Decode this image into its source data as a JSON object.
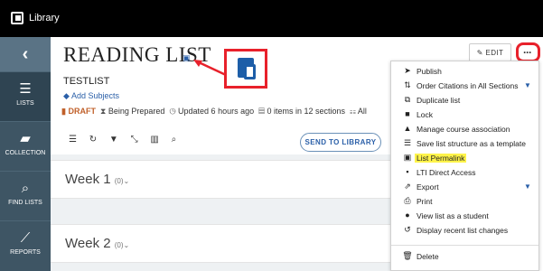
{
  "app": {
    "title": "Library"
  },
  "sidebar": {
    "items": [
      {
        "label": "LISTS",
        "icon": "list-icon"
      },
      {
        "label": "COLLECTION",
        "icon": "folder-icon"
      },
      {
        "label": "FIND LISTS",
        "icon": "search-icon"
      },
      {
        "label": "REPORTS",
        "icon": "chart-icon"
      }
    ]
  },
  "page": {
    "title": "READING LIST",
    "list_name": "TESTLIST",
    "add_subjects": "Add Subjects",
    "meta": {
      "status": "DRAFT",
      "prep": "Being Prepared",
      "updated": "Updated 6 hours ago",
      "items": "0 items in 12 sections",
      "all": "All"
    }
  },
  "toolbar": {
    "send_label": "SEND TO LIBRARY",
    "edit_label": "EDIT",
    "more_label": "···"
  },
  "weeks": [
    {
      "title": "Week 1",
      "count": "(0)"
    },
    {
      "title": "Week 2",
      "count": "(0)"
    }
  ],
  "menu": {
    "items": [
      {
        "label": "Publish",
        "icon": "send-icon"
      },
      {
        "label": "Order Citations in All Sections",
        "icon": "sort-icon",
        "dropdown": "▼"
      },
      {
        "label": "Duplicate list",
        "icon": "copy-icon"
      },
      {
        "label": "Lock",
        "icon": "lock-icon"
      },
      {
        "label": "Manage course association",
        "icon": "graduation-cap-icon"
      },
      {
        "label": "Save list structure as a template",
        "icon": "template-icon"
      },
      {
        "label": "List Permalink",
        "icon": "permalink-icon"
      },
      {
        "label": "LTI Direct Access",
        "icon": "lti-icon"
      },
      {
        "label": "Export",
        "icon": "export-icon",
        "dropdown": "▼"
      },
      {
        "label": "Print",
        "icon": "print-icon"
      },
      {
        "label": "View list as a student",
        "icon": "user-icon"
      },
      {
        "label": "Display recent list changes",
        "icon": "history-icon"
      },
      {
        "label": "Delete",
        "icon": "trash-icon"
      }
    ]
  },
  "colors": {
    "highlight": "#fff34a",
    "annotation": "#e8212b",
    "accent": "#2a5fa8",
    "sidebar": "#3e5564"
  }
}
